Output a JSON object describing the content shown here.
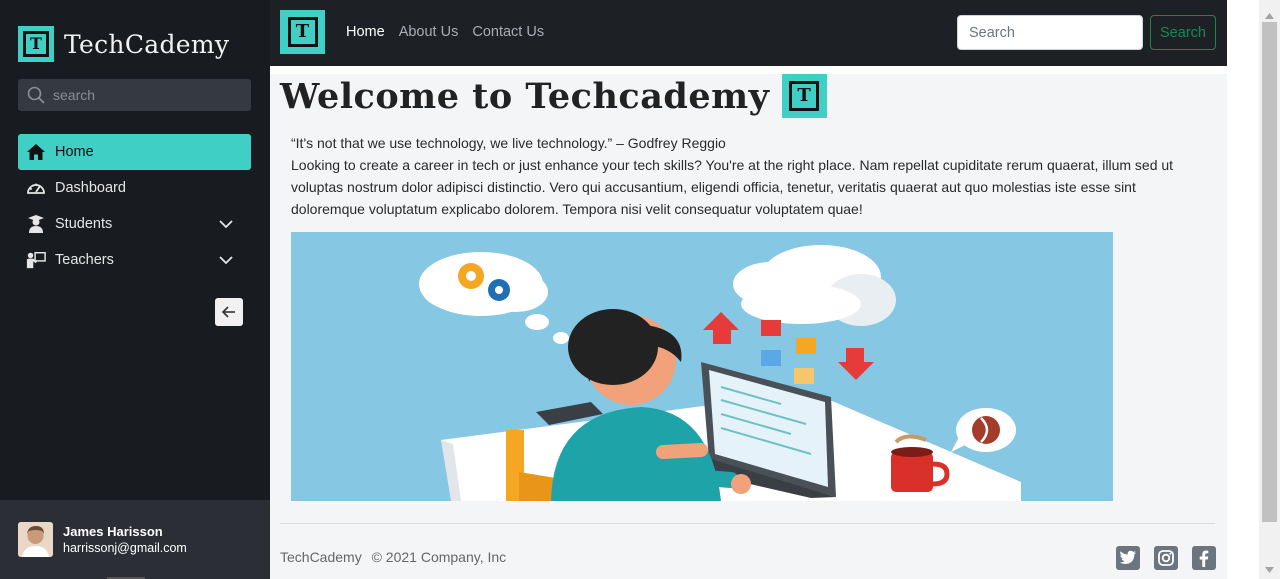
{
  "sidebar": {
    "brand": "TechCademy",
    "logo_letter": "T",
    "search_placeholder": "search",
    "items": [
      {
        "label": "Home",
        "icon": "home-icon",
        "active": true
      },
      {
        "label": "Dashboard",
        "icon": "dashboard-icon",
        "active": false
      },
      {
        "label": "Students",
        "icon": "student-icon",
        "active": false,
        "expandable": true
      },
      {
        "label": "Teachers",
        "icon": "teacher-icon",
        "active": false,
        "expandable": true
      }
    ],
    "collapse_icon": "arrow-left-icon",
    "user": {
      "name": "James Harisson",
      "email": "harrissonj@gmail.com"
    }
  },
  "topbar": {
    "logo_letter": "T",
    "links": [
      {
        "label": "Home",
        "current": true
      },
      {
        "label": "About Us",
        "current": false
      },
      {
        "label": "Contact Us",
        "current": false
      }
    ],
    "search_placeholder": "Search",
    "search_button": "Search"
  },
  "main": {
    "title": "Welcome to Techcademy",
    "title_logo_letter": "T",
    "quote": "“It's not that we use technology, we live technology.” – Godfrey Reggio",
    "paragraph": "Looking to create a career in tech or just enhance your tech skills? You're at the right place. Nam repellat cupiditate rerum quaerat, illum sed ut voluptas nostrum dolor adipisci distinctio. Vero qui accusantium, eligendi officia, tenetur, veritatis quaerat aut quo molestias iste esse sint doloremque voluptatum explicabo dolorem. Tempora nisi velit consequatur voluptatem quae!"
  },
  "footer": {
    "brand": "TechCademy",
    "copyright": "© 2021 Company, Inc",
    "socials": [
      "twitter-icon",
      "instagram-icon",
      "facebook-icon"
    ]
  },
  "colors": {
    "accent": "#3fcfc4",
    "sidebar_bg": "#181c21",
    "topbar_bg": "#1d2126",
    "success": "#198754"
  }
}
